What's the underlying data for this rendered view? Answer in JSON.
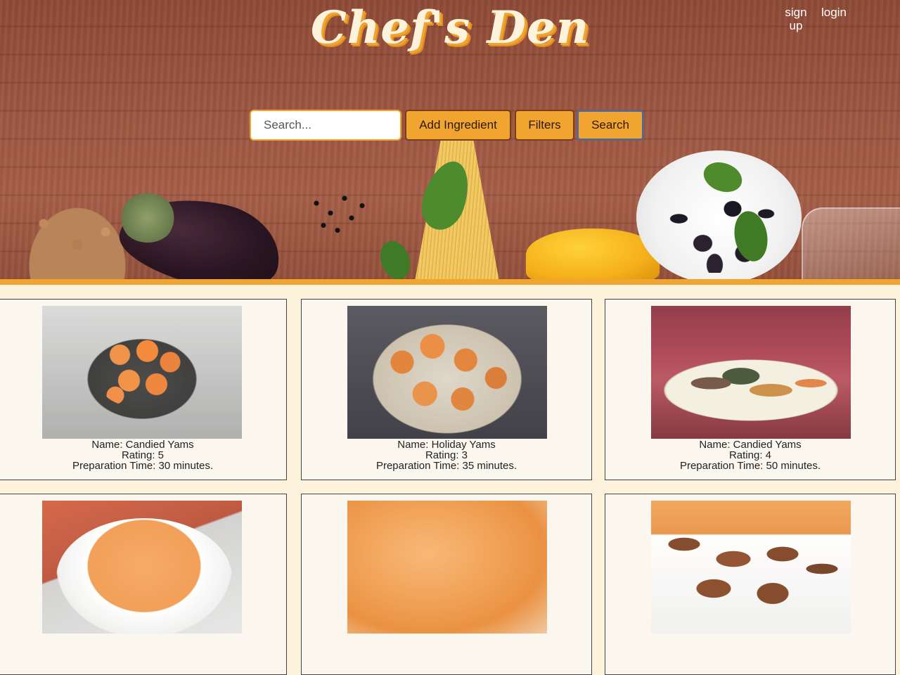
{
  "header": {
    "logo": "Chef's Den",
    "signup_label": "sign up",
    "login_label": "login"
  },
  "search": {
    "placeholder": "Search...",
    "value": "",
    "add_ingredient_label": "Add Ingredient",
    "filters_label": "Filters",
    "search_label": "Search"
  },
  "colors": {
    "accent": "#f2a431",
    "page_background": "#fdf3dc",
    "card_background": "#fcf7ee"
  },
  "recipes": [
    {
      "name": "Name: Candied Yams",
      "rating": "Rating: 5",
      "prep": "Preparation Time: 30 minutes."
    },
    {
      "name": "Name: Holiday Yams",
      "rating": "Rating: 3",
      "prep": "Preparation Time: 35 minutes."
    },
    {
      "name": "Name: Candied Yams",
      "rating": "Rating: 4",
      "prep": "Preparation Time: 50 minutes."
    }
  ]
}
